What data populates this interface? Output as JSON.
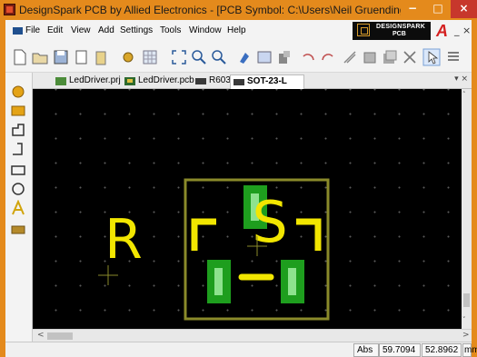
{
  "window": {
    "title": "DesignSpark PCB by Allied Electronics - [PCB Symbol: C:\\Users\\Neil Gruending\\Perforce...",
    "minimize_glyph": "−",
    "maximize_glyph": "□",
    "close_glyph": "×"
  },
  "menu": {
    "items": [
      "File",
      "Edit",
      "View",
      "Add",
      "Settings",
      "Tools",
      "Window",
      "Help"
    ],
    "brand_line1": "DESIGNSPARK",
    "brand_line2": "PCB",
    "brand_letter": "A",
    "tail": "_ ×"
  },
  "toolbar": {
    "icons": [
      "new-file-icon",
      "open-folder-icon",
      "save-icon",
      "copy-icon",
      "paste-icon",
      "wizard-icon",
      "grid-icon",
      "zoom-fit-icon",
      "zoom-in-icon",
      "zoom-out-icon",
      "paint-icon",
      "layers-icon",
      "design-icon",
      "undo-icon",
      "redo-icon",
      "ratsnest-icon",
      "components-icon",
      "libraries-icon",
      "delete-icon",
      "select-icon",
      "list-icon"
    ]
  },
  "tabs": [
    {
      "label": "LedDriver.prj",
      "icon": "project-icon",
      "active": false
    },
    {
      "label": "LedDriver.pcb",
      "icon": "pcb-icon",
      "active": false
    },
    {
      "label": "R603",
      "icon": "symbol-icon",
      "active": false
    },
    {
      "label": "SOT-23-L",
      "icon": "symbol-icon",
      "active": true
    }
  ],
  "tabs_more": "▾ ×",
  "canvas": {
    "designator": "R",
    "symbol_name": "S",
    "outline_color": "#8a8a2a",
    "pad_color": "#1e9e1e",
    "pad_inner_color": "#8ee28e",
    "silkscreen_color": "#f2e600",
    "background": "#000000"
  },
  "statusbar": {
    "mode": "Abs",
    "x": "59.7094",
    "y": "52.8962",
    "units": "mm"
  },
  "scroll": {
    "left": "<",
    "right": ">",
    "up": "˄",
    "down": "˅"
  }
}
